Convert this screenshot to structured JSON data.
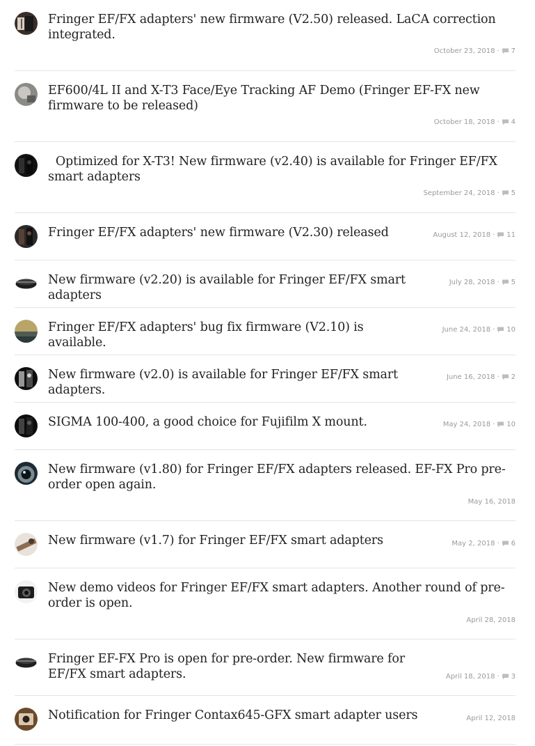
{
  "posts": [
    {
      "title": "Fringer EF/FX adapters' new firmware (V2.50) released. LaCA correction integrated.",
      "date": "October 23, 2018",
      "comments": "7",
      "avatar_icon": "lens-adapter-photo-icon",
      "avatar_colors": [
        "#3a2e28",
        "#d8cfc6",
        "#1a1a1a"
      ]
    },
    {
      "title": "EF600/4L II and X-T3 Face/Eye Tracking AF Demo (Fringer EF-FX new firmware to be released)",
      "date": "October 18, 2018",
      "comments": "4",
      "avatar_icon": "telephoto-lens-photo-icon",
      "avatar_colors": [
        "#8a8a86",
        "#c9c7c0",
        "#5c5c58"
      ]
    },
    {
      "title": "  Optimized for X-T3! New firmware (v2.40) is available for Fringer EF/FX smart adapters",
      "date": "September 24, 2018",
      "comments": "5",
      "avatar_icon": "camera-photo-icon",
      "avatar_colors": [
        "#121212",
        "#3c3c3c",
        "#0a0a0a"
      ]
    },
    {
      "title": "Fringer EF/FX adapters' new firmware (V2.30) released",
      "date": "August 12, 2018",
      "comments": "11",
      "avatar_icon": "lens-lineup-photo-icon",
      "avatar_colors": [
        "#2a2a2a",
        "#6b4a3a",
        "#111111"
      ]
    },
    {
      "title": "New firmware (v2.20) is available for Fringer EF/FX smart adapters",
      "date": "July 28, 2018",
      "comments": "5",
      "avatar_icon": "adapter-ring-photo-icon",
      "avatar_colors": [
        "#ffffff",
        "#1e1e1e",
        "#3b3b3b"
      ]
    },
    {
      "title": "Fringer EF/FX adapters' bug fix firmware (V2.10) is available.",
      "date": "June 24, 2018",
      "comments": "10",
      "avatar_icon": "sunset-photo-icon",
      "avatar_colors": [
        "#b9a56a",
        "#4f5a52",
        "#2d3a3a"
      ]
    },
    {
      "title": "New firmware (v2.0) is available for Fringer EF/FX smart adapters.",
      "date": "June 16, 2018",
      "comments": "2",
      "avatar_icon": "lens-mount-photo-icon",
      "avatar_colors": [
        "#0e0e0e",
        "#cfcfcf",
        "#4a4a4a"
      ]
    },
    {
      "title": "SIGMA 100-400, a good choice for Fujifilm X mount.",
      "date": "May 24, 2018",
      "comments": "10",
      "avatar_icon": "night-photo-icon",
      "avatar_colors": [
        "#0c0c0c",
        "#5a5a5a",
        "#1f1f1f"
      ]
    },
    {
      "title": "New firmware (v1.80) for Fringer EF/FX adapters released. EF-FX Pro pre-order open again.",
      "date": "May 16, 2018",
      "comments": "",
      "avatar_icon": "lens-front-photo-icon",
      "avatar_colors": [
        "#1c2a33",
        "#7a8a90",
        "#0d1418"
      ]
    },
    {
      "title": "New firmware (v1.7) for Fringer EF/FX smart adapters",
      "date": "May 2, 2018",
      "comments": "6",
      "avatar_icon": "lens-detail-photo-icon",
      "avatar_colors": [
        "#e8e2da",
        "#8c6d52",
        "#4a3a2e"
      ]
    },
    {
      "title": "New demo videos for Fringer EF/FX smart adapters. Another round of pre-order is open.",
      "date": "April 28, 2018",
      "comments": "",
      "avatar_icon": "camera-body-photo-icon",
      "avatar_colors": [
        "#f2f2f2",
        "#1c1c1c",
        "#5c5c5c"
      ]
    },
    {
      "title": "Fringer EF-FX Pro is open for pre-order. New firmware for EF/FX smart adapters.",
      "date": "April 18, 2018",
      "comments": "3",
      "avatar_icon": "adapter-ring-photo-icon",
      "avatar_colors": [
        "#ffffff",
        "#1e1e1e",
        "#3b3b3b"
      ]
    },
    {
      "title": "Notification for Fringer Contax645-GFX smart adapter users",
      "date": "April 12, 2018",
      "comments": "",
      "avatar_icon": "medium-format-adapter-photo-icon",
      "avatar_colors": [
        "#6a4a2a",
        "#d9c8b0",
        "#2e1f14"
      ]
    }
  ],
  "colors": {
    "title_text": "#222222",
    "meta_text": "#9a9a9a",
    "divider": "#e4e4e4",
    "comment_icon": "#bdbdbd"
  },
  "meta_separator": "·"
}
